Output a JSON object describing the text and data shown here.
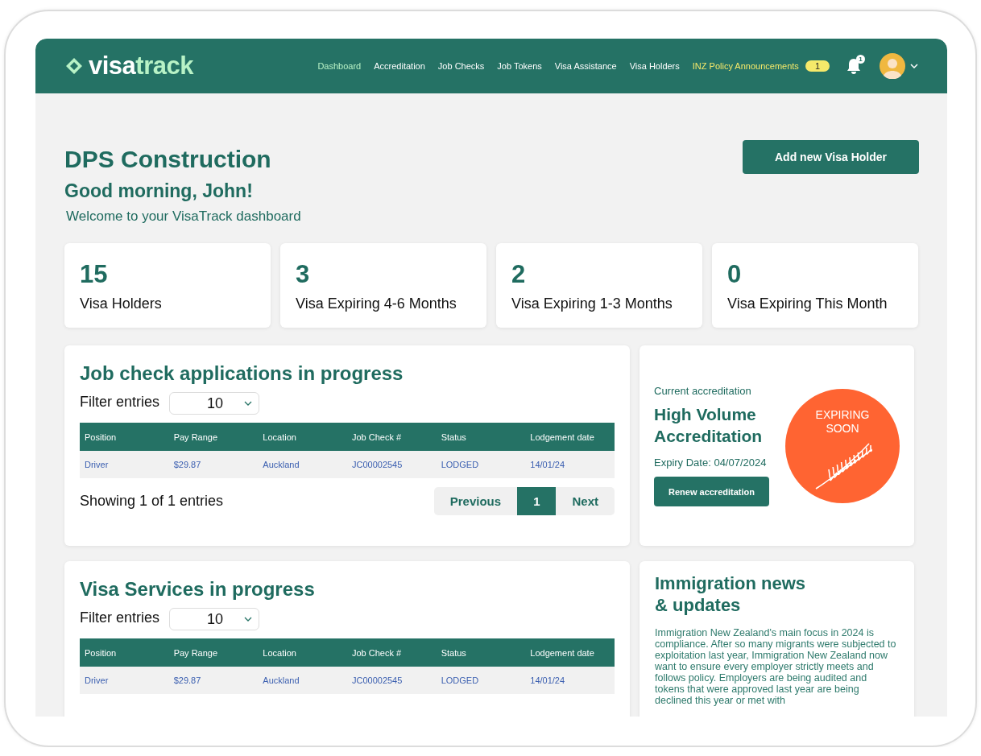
{
  "header": {
    "logo_parts": [
      "visa",
      "track"
    ],
    "nav": [
      {
        "label": "Dashboard",
        "selected": true
      },
      {
        "label": "Accreditation",
        "selected": false
      },
      {
        "label": "Job Checks",
        "selected": false
      },
      {
        "label": "Job Tokens",
        "selected": false
      },
      {
        "label": "Visa Assistance",
        "selected": false
      },
      {
        "label": "Visa Holders",
        "selected": false
      },
      {
        "label": "INZ Policy Announcements",
        "selected": false,
        "badge": "1"
      }
    ],
    "notification_count": "1"
  },
  "company": "DPS Construction",
  "greeting": "Good morning, John!",
  "welcome": "Welcome to your VisaTrack dashboard",
  "add_button": "Add new Visa Holder",
  "stats": [
    {
      "value": "15",
      "label": "Visa Holders"
    },
    {
      "value": "3",
      "label": "Visa Expiring 4-6 Months"
    },
    {
      "value": "2",
      "label": "Visa Expiring 1-3 Months"
    },
    {
      "value": "0",
      "label": "Visa Expiring This Month"
    }
  ],
  "tables": [
    {
      "title": "Job check applications in progress",
      "filter_label": "Filter entries",
      "filter_value": "10",
      "columns": [
        "Position",
        "Pay Range",
        "Location",
        "Job Check #",
        "Status",
        "Lodgement date"
      ],
      "rows": [
        [
          "Driver",
          "$29.87",
          "Auckland",
          "JC00002545",
          "LODGED",
          "14/01/24"
        ]
      ],
      "showing": "Showing 1 of 1 entries",
      "pagination": [
        {
          "label": "Previous",
          "selected": false
        },
        {
          "label": "1",
          "selected": true
        },
        {
          "label": "Next",
          "selected": false
        }
      ]
    },
    {
      "title": "Visa Services in progress",
      "filter_label": "Filter entries",
      "filter_value": "10",
      "columns": [
        "Position",
        "Pay Range",
        "Location",
        "Job Check #",
        "Status",
        "Lodgement date"
      ],
      "rows": [
        [
          "Driver",
          "$29.87",
          "Auckland",
          "JC00002545",
          "LODGED",
          "14/01/24"
        ]
      ]
    }
  ],
  "accreditation": {
    "label": "Current accreditation",
    "name": "High Volume Accreditation",
    "expiry": "Expiry Date: 04/07/2024",
    "button": "Renew accreditation",
    "badge": "EXPIRING SOON"
  },
  "news": {
    "title": "Immigration news & updates",
    "body": "Immigration New Zealand's main focus in 2024 is compliance. After so many migrants were subjected to exploitation last year, Immigration New Zealand now want to ensure every employer strictly meets and follows policy. Employers are being audited and tokens that were approved last year are being declined this year or met with"
  }
}
